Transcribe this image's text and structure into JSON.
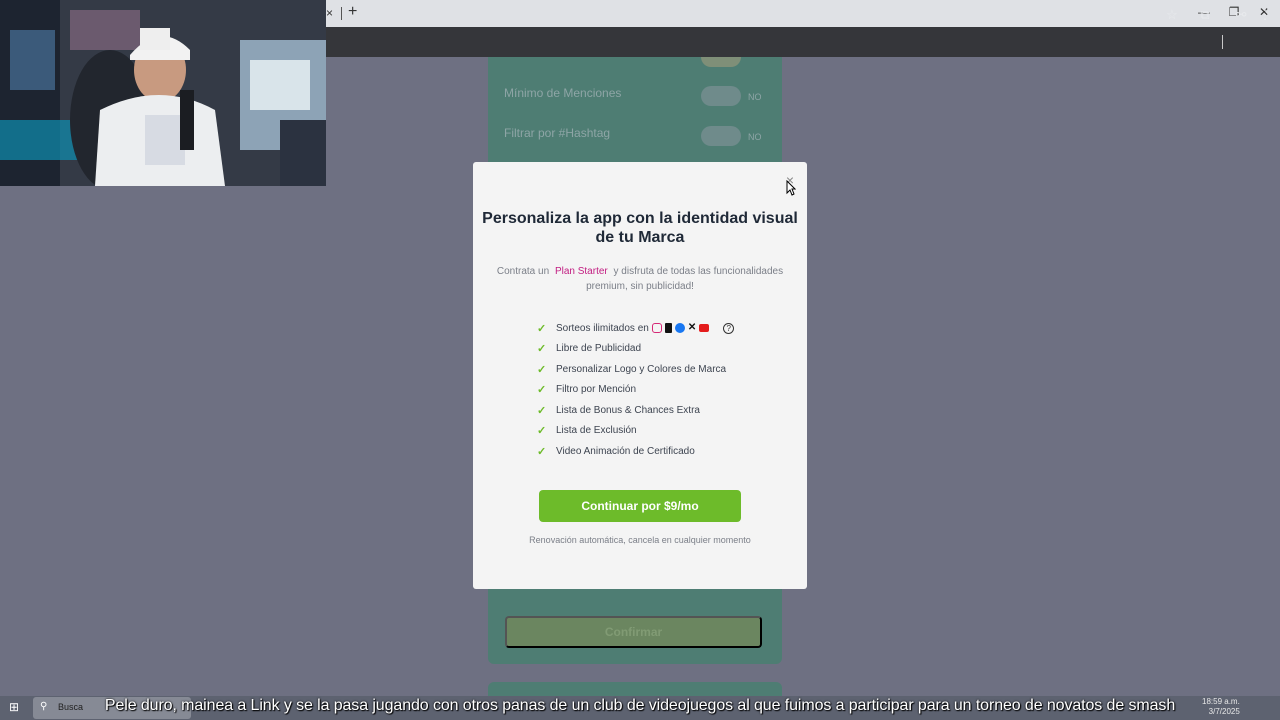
{
  "browser": {
    "tab_close": "×",
    "new_tab": "+",
    "window_controls": [
      "—",
      "❐",
      "✕"
    ],
    "toolbar_icons": [
      "star-icon",
      "extensions-icon",
      "profile-icon",
      "menu-icon"
    ]
  },
  "background_page": {
    "rows": [
      {
        "label": "Mínimo de Menciones",
        "state": "NO"
      },
      {
        "label": "Filtrar por #Hashtag",
        "state": "NO"
      }
    ],
    "confirm_label": "Confirmar"
  },
  "modal": {
    "close_label": "×",
    "title": "Personaliza la app con la identidad visual de tu Marca",
    "desc_prefix": "Contrata un",
    "plan_name": "Plan Starter",
    "desc_suffix": "y disfruta de todas las funcionalidades premium, sin publicidad!",
    "features": [
      "Sorteos ilimitados en",
      "Libre de Publicidad",
      "Personalizar Logo y Colores de Marca",
      "Filtro por Mención",
      "Lista de Bonus & Chances Extra",
      "Lista de Exclusión",
      "Video Animación de Certificado"
    ],
    "social_icons": [
      "instagram-icon",
      "tiktok-icon",
      "facebook-icon",
      "x-icon",
      "youtube-icon"
    ],
    "cta_label": "Continuar por $9/mo",
    "renewal_note": "Renovación automática, cancela en cualquier momento"
  },
  "taskbar": {
    "search_text": "Busca",
    "time": "18:59 a.m.",
    "date": "3/7/2025"
  },
  "caption": "Pele duro, mainea a Link y se la pasa jugando con otros panas de un club de videojuegos al que fuimos a participar para un torneo de novatos de smash",
  "colors": {
    "accent_green": "#6dbb2a",
    "plan_magenta": "#c21e82",
    "overlay": "#6e7082"
  }
}
